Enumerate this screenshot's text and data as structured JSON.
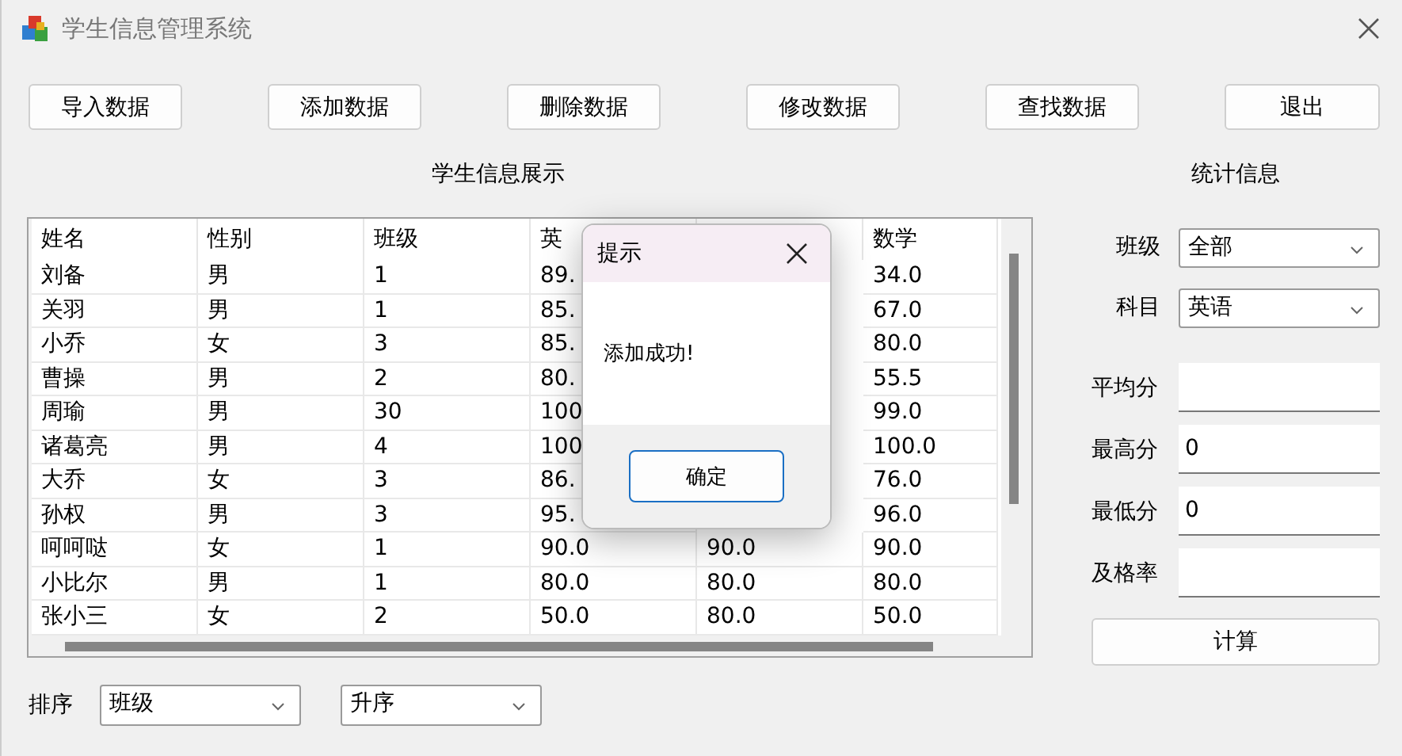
{
  "window": {
    "title": "学生信息管理系统"
  },
  "toolbar": [
    "导入数据",
    "添加数据",
    "删除数据",
    "修改数据",
    "查找数据",
    "退出"
  ],
  "table_section": {
    "title": "学生信息展示",
    "columns": [
      "姓名",
      "性别",
      "班级",
      "英",
      null,
      "数学"
    ],
    "rows": [
      [
        "刘备",
        "男",
        "1",
        "89.",
        null,
        "34.0"
      ],
      [
        "关羽",
        "男",
        "1",
        "85.",
        null,
        "67.0"
      ],
      [
        "小乔",
        "女",
        "3",
        "85.",
        null,
        "80.0"
      ],
      [
        "曹操",
        "男",
        "2",
        "80.",
        null,
        "55.5"
      ],
      [
        "周瑜",
        "男",
        "30",
        "100",
        null,
        "99.0"
      ],
      [
        "诸葛亮",
        "男",
        "4",
        "100",
        null,
        "100.0"
      ],
      [
        "大乔",
        "女",
        "3",
        "86.",
        null,
        "76.0"
      ],
      [
        "孙权",
        "男",
        "3",
        "95.",
        null,
        "96.0"
      ],
      [
        "呵呵哒",
        "女",
        "1",
        "90.0",
        "90.0",
        "90.0"
      ],
      [
        "小比尔",
        "男",
        "1",
        "80.0",
        "80.0",
        "80.0"
      ],
      [
        "张小三",
        "女",
        "2",
        "50.0",
        "80.0",
        "50.0"
      ]
    ]
  },
  "sort": {
    "label": "排序",
    "field": "班级",
    "order": "升序"
  },
  "stats": {
    "title": "统计信息",
    "filters": [
      {
        "label": "班级",
        "value": "全部"
      },
      {
        "label": "科目",
        "value": "英语"
      }
    ],
    "results": [
      {
        "label": "平均分"
      },
      {
        "label": "最高分",
        "value": "0"
      },
      {
        "label": "最低分",
        "value": "0"
      },
      {
        "label": "及格率"
      }
    ],
    "button": "计算"
  },
  "dialog": {
    "title": "提示",
    "message": "添加成功!",
    "button": "确定"
  }
}
